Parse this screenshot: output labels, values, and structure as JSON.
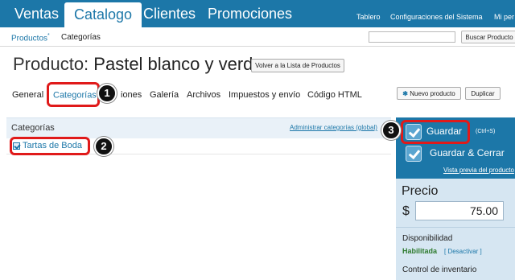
{
  "topnav": {
    "tabs": [
      {
        "label": "Ventas"
      },
      {
        "label": "Catalogo"
      },
      {
        "label": "Clientes"
      },
      {
        "label": "Promociones"
      }
    ],
    "utility_links": [
      "Tablero",
      "Configuraciones del Sistema",
      "Mi per"
    ]
  },
  "subnav": {
    "items": [
      {
        "label": "Productos"
      },
      {
        "label": "Categorías"
      }
    ],
    "superscript": "*",
    "search_value": "",
    "search_button": "Buscar Producto"
  },
  "page": {
    "title_prefix": "Producto:",
    "product_name": "Pastel blanco y verde",
    "back_button": "Volver a la Lista de Productos"
  },
  "section_tabs": [
    {
      "label": "General"
    },
    {
      "label": "Categorías"
    },
    {
      "label": "iones"
    },
    {
      "label": "Galería"
    },
    {
      "label": "Archivos"
    },
    {
      "label": "Impuestos y envío"
    },
    {
      "label": "Código HTML"
    }
  ],
  "actions": {
    "new_product_icon": "✱",
    "new_product": "Nuevo producto",
    "duplicate": "Duplicar"
  },
  "categories_panel": {
    "header": "Categorías",
    "admin_link": "Administrar categorías (global)",
    "items": [
      {
        "label": "Tartas de Boda",
        "checked": true
      }
    ]
  },
  "save_panel": {
    "save": "Guardar",
    "shortcut": "(Ctrl+S)",
    "save_close": "Guardar & Cerrar",
    "preview_link": "Vista previa del producto"
  },
  "price": {
    "label": "Precio",
    "currency": "$",
    "value": "75.00"
  },
  "availability": {
    "label": "Disponibilidad",
    "status": "Habilitada",
    "deactivate": "[ Desactivar ]"
  },
  "inventory": {
    "label": "Control de inventario"
  },
  "callouts": [
    "1",
    "2",
    "3"
  ],
  "colors": {
    "brand_blue": "#1c77a8",
    "highlight_red": "#e01a1a",
    "enabled_green": "#2d7a2d"
  }
}
